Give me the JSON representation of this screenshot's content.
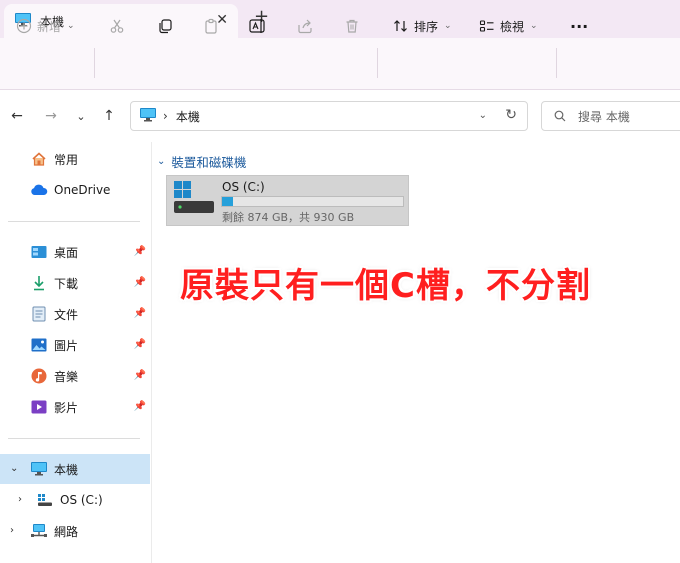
{
  "window": {
    "tab_title": "本機",
    "tab_close": "✕",
    "new_tab": "+"
  },
  "toolbar": {
    "new_label": "新增",
    "sort_label": "排序",
    "view_label": "檢視",
    "more_label": "···"
  },
  "address": {
    "path": "本機",
    "separator": "›",
    "search_placeholder": "搜尋 本機"
  },
  "sidebar": {
    "home": "常用",
    "onedrive": "OneDrive",
    "quick": [
      {
        "label": "桌面",
        "icon": "desktop-icon"
      },
      {
        "label": "下載",
        "icon": "download-icon"
      },
      {
        "label": "文件",
        "icon": "document-icon"
      },
      {
        "label": "圖片",
        "icon": "picture-icon"
      },
      {
        "label": "音樂",
        "icon": "music-icon"
      },
      {
        "label": "影片",
        "icon": "video-icon"
      }
    ],
    "this_pc": "本機",
    "os_drive": "OS (C:)",
    "network": "網路"
  },
  "main": {
    "group_title": "裝置和磁碟機",
    "drive": {
      "name": "OS (C:)",
      "space_text": "剩餘 874 GB，共 930 GB",
      "used_fraction": 0.06
    }
  },
  "annotation": {
    "text": "原裝只有一個C槽，不分割",
    "color": "#ff1f1f"
  },
  "colors": {
    "accent": "#26a0da",
    "selected": "#cce4f7",
    "chrome": "#f3e8f4"
  }
}
